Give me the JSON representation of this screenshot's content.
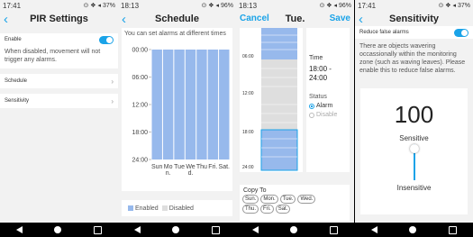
{
  "panel1": {
    "status": {
      "time": "17:41",
      "right": "⊙ ❖ ◂ 37%"
    },
    "title": "PIR Settings",
    "enable_label": "Enable",
    "enable_hint": "When disabled, movement will not trigger any alarms.",
    "schedule_label": "Schedule",
    "sensitivity_label": "Sensitivity"
  },
  "panel2": {
    "status": {
      "time": "18:13",
      "right": "⊙ ❖ ◂ 96%"
    },
    "title": "Schedule",
    "subtitle": "You can set alarms at different times",
    "legend_enabled": "Enabled",
    "legend_disabled": "Disabled"
  },
  "panel3": {
    "status": {
      "time": "18:13",
      "right": "⊙ ❖ ◂ 96%"
    },
    "cancel": "Cancel",
    "title": "Tue.",
    "save": "Save",
    "time_label": "Time",
    "time_value": "18:00 - 24:00",
    "status_label": "Status",
    "alarm_option": "Alarm",
    "disable_option": "Disable",
    "copy_to": "Copy To",
    "days": [
      "Sun.",
      "Mon.",
      "Tue.",
      "Wed.",
      "Thu.",
      "Fri.",
      "Sat."
    ],
    "ticks": [
      "06:00",
      "12:00",
      "18:00",
      "24:00"
    ]
  },
  "panel4": {
    "status": {
      "time": "17:41",
      "right": "⊙ ❖ ◂ 37%"
    },
    "title": "Sensitivity",
    "reduce_label": "Reduce false alarms",
    "reduce_hint": "There are objects wavering occassionally within the monitoring zone (such as waving leaves). Please enable this to reduce false alarms.",
    "value": "100",
    "level": 1.0,
    "sensitive_label": "Sensitive",
    "insensitive_label": "Insensitive"
  },
  "chart_data": {
    "type": "bar",
    "categories": [
      "Sun",
      "Mon",
      "Tue",
      "Wed",
      "Thu",
      "Fri",
      "Sat"
    ],
    "category_labels": [
      "Sun",
      "Mo\nn.",
      "Tue",
      "We\nd.",
      "Thu",
      "Fri.",
      "Sat."
    ],
    "y_ticks": [
      "00:00",
      "06:00",
      "12:00",
      "18:00",
      "24:00"
    ],
    "ylim": [
      0,
      24
    ],
    "series": [
      {
        "name": "Enabled",
        "values": [
          [
            0,
            24
          ],
          [
            0,
            24
          ],
          [
            0,
            24
          ],
          [
            0,
            24
          ],
          [
            0,
            24
          ],
          [
            0,
            24
          ],
          [
            0,
            24
          ]
        ]
      }
    ],
    "legend": [
      "Enabled",
      "Disabled"
    ],
    "colors": {
      "enabled": "#97b9ec",
      "disabled": "#dedede"
    }
  },
  "colors": {
    "accent": "#1aa3e8",
    "bar": "#97b9ec",
    "disabled": "#dedede"
  }
}
